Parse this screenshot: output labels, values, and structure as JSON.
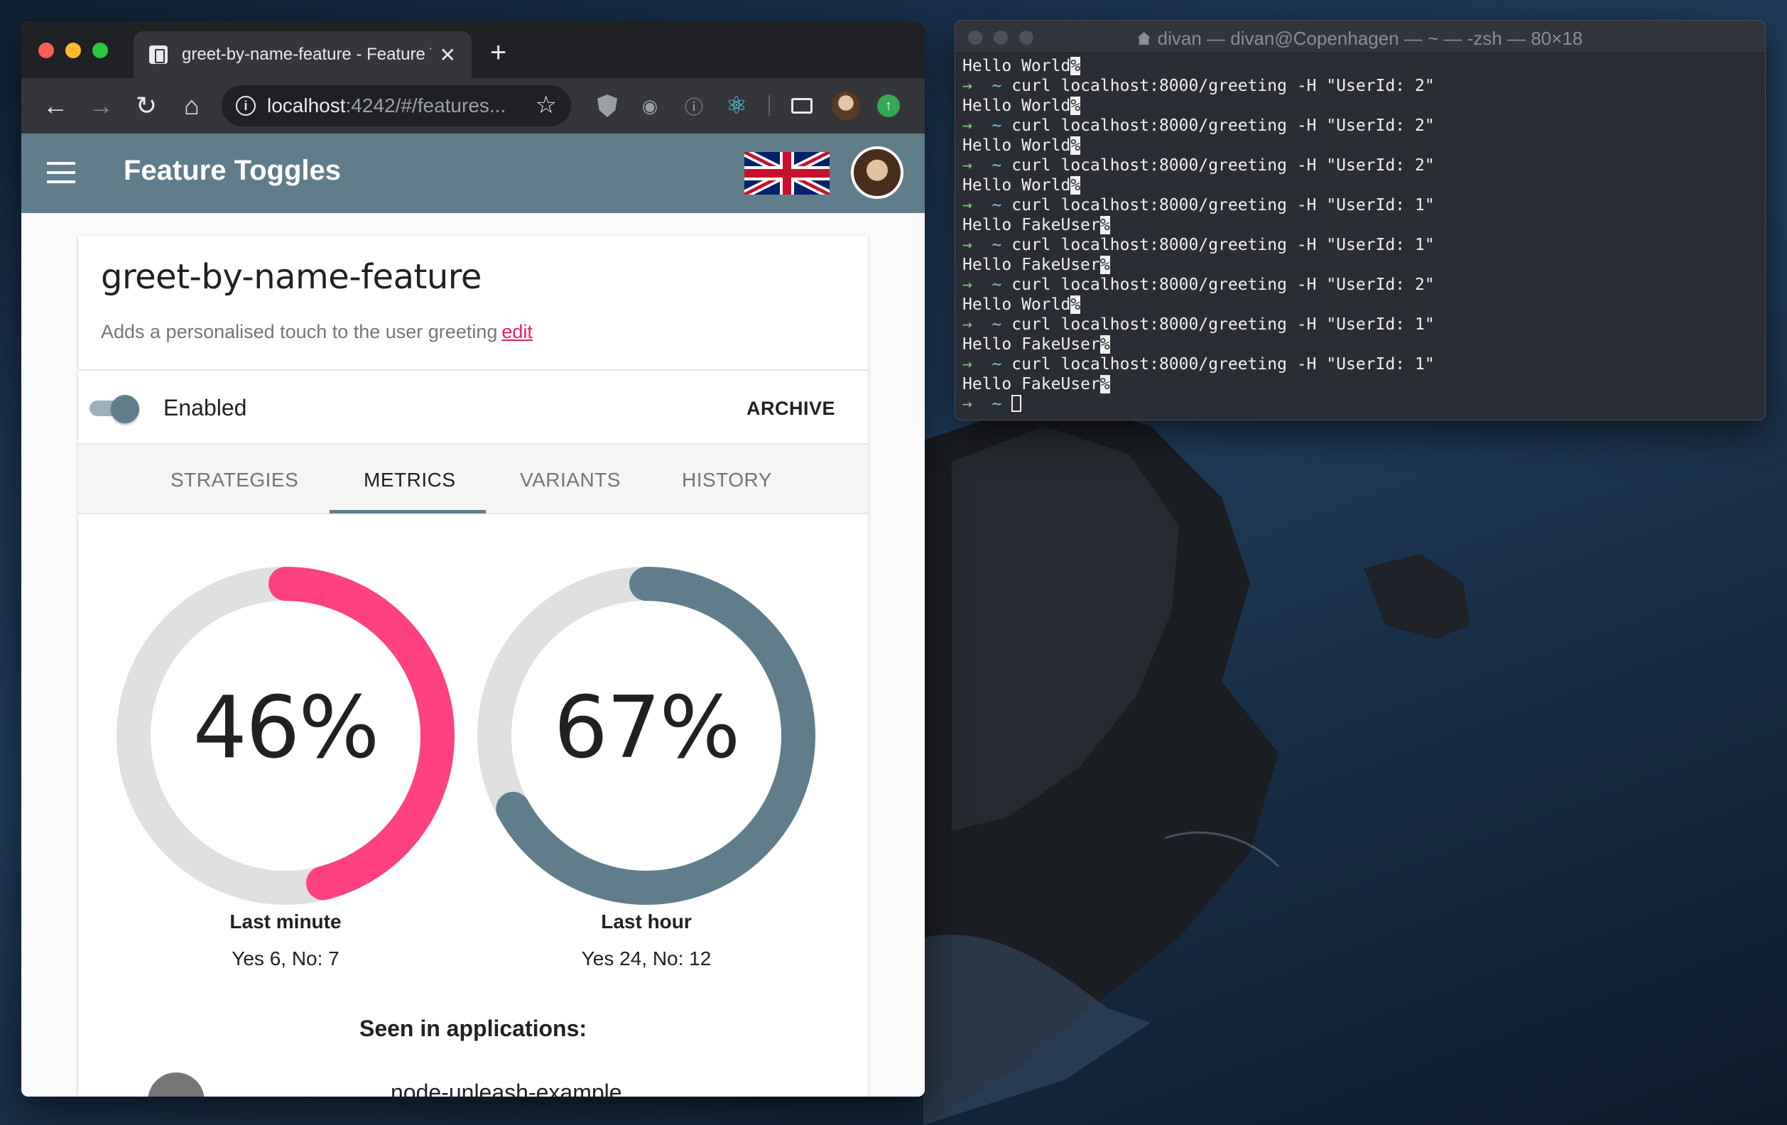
{
  "browser": {
    "tab_title": "greet-by-name-feature - Feature Toggles",
    "new_tab_label": "+",
    "close_label": "✕",
    "url_host": "localhost",
    "url_rest": ":4242/#/features...",
    "nav": {
      "back": "←",
      "forward": "→",
      "reload": "↻",
      "home": "⌂",
      "bookmark": "☆"
    }
  },
  "app": {
    "title": "Feature Toggles",
    "feature": {
      "name": "greet-by-name-feature",
      "description": "Adds a personalised touch to the user greeting",
      "edit_label": "edit",
      "enabled_label": "Enabled",
      "enabled": true,
      "archive_label": "ARCHIVE"
    },
    "tabs": [
      {
        "label": "STRATEGIES",
        "active": false
      },
      {
        "label": "METRICS",
        "active": true
      },
      {
        "label": "VARIANTS",
        "active": false
      },
      {
        "label": "HISTORY",
        "active": false
      }
    ],
    "metrics": [
      {
        "percent_label": "46%",
        "fraction": 0.46,
        "title": "Last minute",
        "detail": "Yes 6, No: 7",
        "color": "#ff4081"
      },
      {
        "percent_label": "67%",
        "fraction": 0.67,
        "title": "Last hour",
        "detail": "Yes 24, No: 12",
        "color": "#607d8b"
      }
    ],
    "seen_title": "Seen in applications:",
    "applications": [
      {
        "name": "node-unleash-example"
      }
    ]
  },
  "terminal": {
    "title": "divan — divan@Copenhagen — ~ — -zsh — 80×18",
    "lines": [
      {
        "kind": "output",
        "text": "Hello World"
      },
      {
        "kind": "cmd",
        "text": "curl localhost:8000/greeting -H \"UserId: 2\""
      },
      {
        "kind": "output",
        "text": "Hello World"
      },
      {
        "kind": "cmd",
        "text": "curl localhost:8000/greeting -H \"UserId: 2\""
      },
      {
        "kind": "output",
        "text": "Hello World"
      },
      {
        "kind": "cmd",
        "text": "curl localhost:8000/greeting -H \"UserId: 2\""
      },
      {
        "kind": "output",
        "text": "Hello World"
      },
      {
        "kind": "cmd",
        "text": "curl localhost:8000/greeting -H \"UserId: 1\""
      },
      {
        "kind": "output",
        "text": "Hello FakeUser"
      },
      {
        "kind": "cmd",
        "text": "curl localhost:8000/greeting -H \"UserId: 1\""
      },
      {
        "kind": "output",
        "text": "Hello FakeUser"
      },
      {
        "kind": "cmd",
        "text": "curl localhost:8000/greeting -H \"UserId: 2\""
      },
      {
        "kind": "output",
        "text": "Hello World"
      },
      {
        "kind": "cmd",
        "text": "curl localhost:8000/greeting -H \"UserId: 1\""
      },
      {
        "kind": "output",
        "text": "Hello FakeUser"
      },
      {
        "kind": "cmd",
        "text": "curl localhost:8000/greeting -H \"UserId: 1\""
      },
      {
        "kind": "output",
        "text": "Hello FakeUser"
      },
      {
        "kind": "prompt",
        "text": ""
      }
    ]
  },
  "colors": {
    "accent_pink": "#ff4081",
    "bluegrey": "#607d8b",
    "link": "#e91e63"
  }
}
